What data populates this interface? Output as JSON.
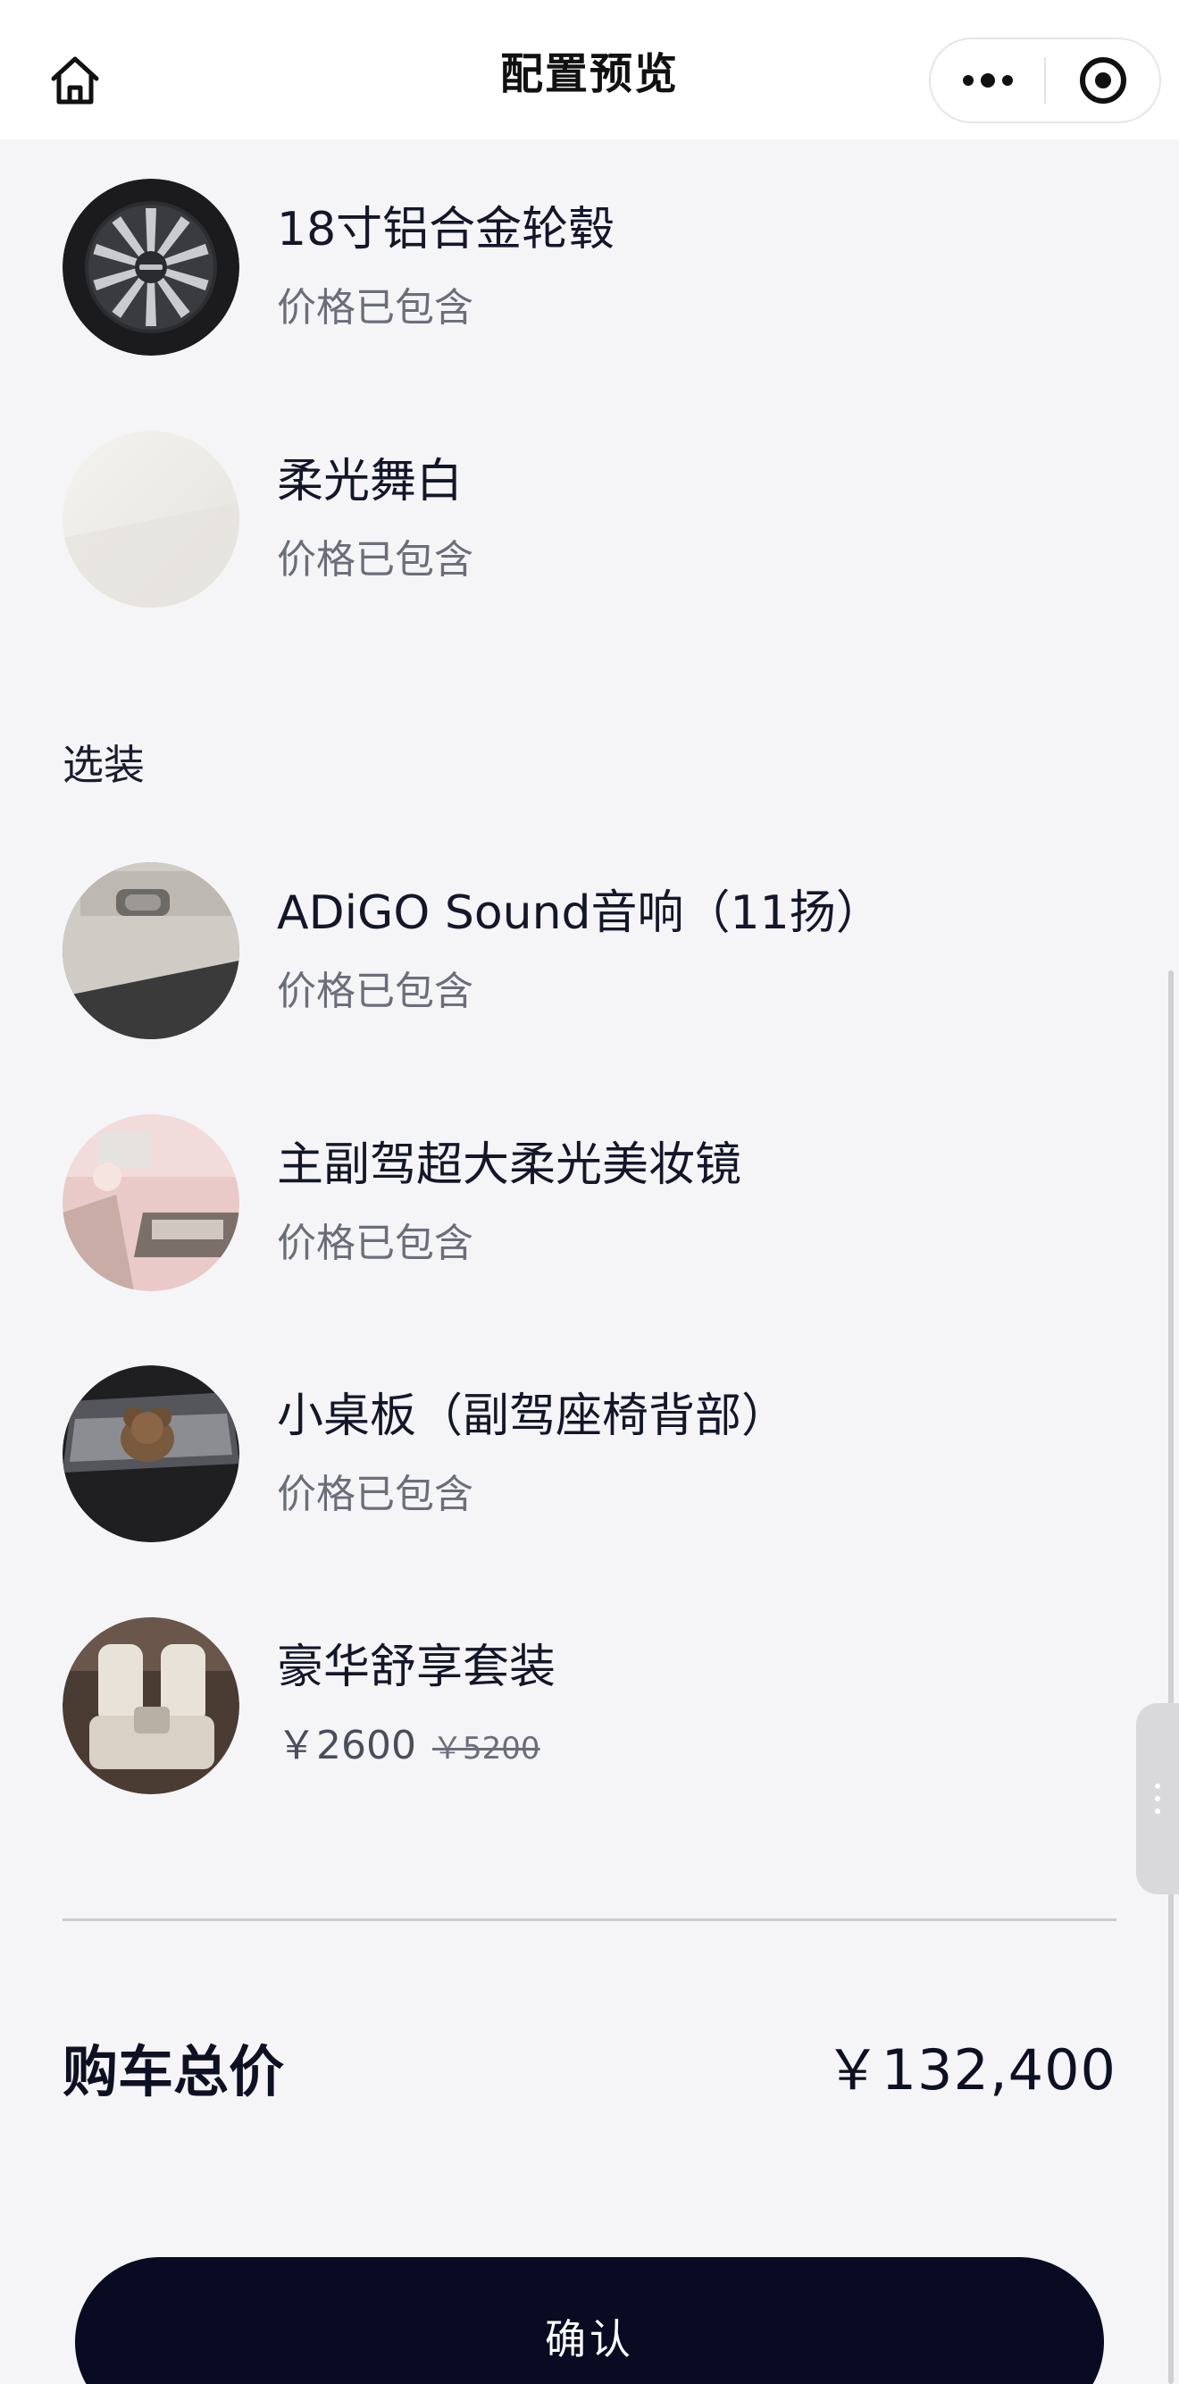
{
  "header": {
    "title": "配置预览",
    "home_icon": "home-icon",
    "more_icon": "more-dots-icon",
    "close_icon": "target-circle-icon"
  },
  "standard_items": [
    {
      "name": "18寸铝合金轮毂",
      "price_text": "价格已包含",
      "icon": "wheel-thumbnail"
    },
    {
      "name": "柔光舞白",
      "price_text": "价格已包含",
      "icon": "paint-color-thumbnail"
    }
  ],
  "optional_section": {
    "title": "选装",
    "items": [
      {
        "name": "ADiGO Sound音响（11扬）",
        "price_text": "价格已包含",
        "icon": "door-panel-thumbnail"
      },
      {
        "name": "主副驾超大柔光美妆镜",
        "price_text": "价格已包含",
        "icon": "mirror-thumbnail"
      },
      {
        "name": "小桌板（副驾座椅背部）",
        "price_text": "价格已包含",
        "icon": "table-thumbnail"
      },
      {
        "name": "豪华舒享套装",
        "price_now": "￥2600",
        "price_old": "￥5200",
        "icon": "seat-thumbnail"
      }
    ]
  },
  "total": {
    "label": "购车总价",
    "value": "￥132,400"
  },
  "confirm": {
    "label": "确认"
  },
  "colors": {
    "background": "#f5f5f7",
    "primary_button": "#080b22",
    "text_primary": "#14162a",
    "text_secondary": "#6b6e7a"
  }
}
